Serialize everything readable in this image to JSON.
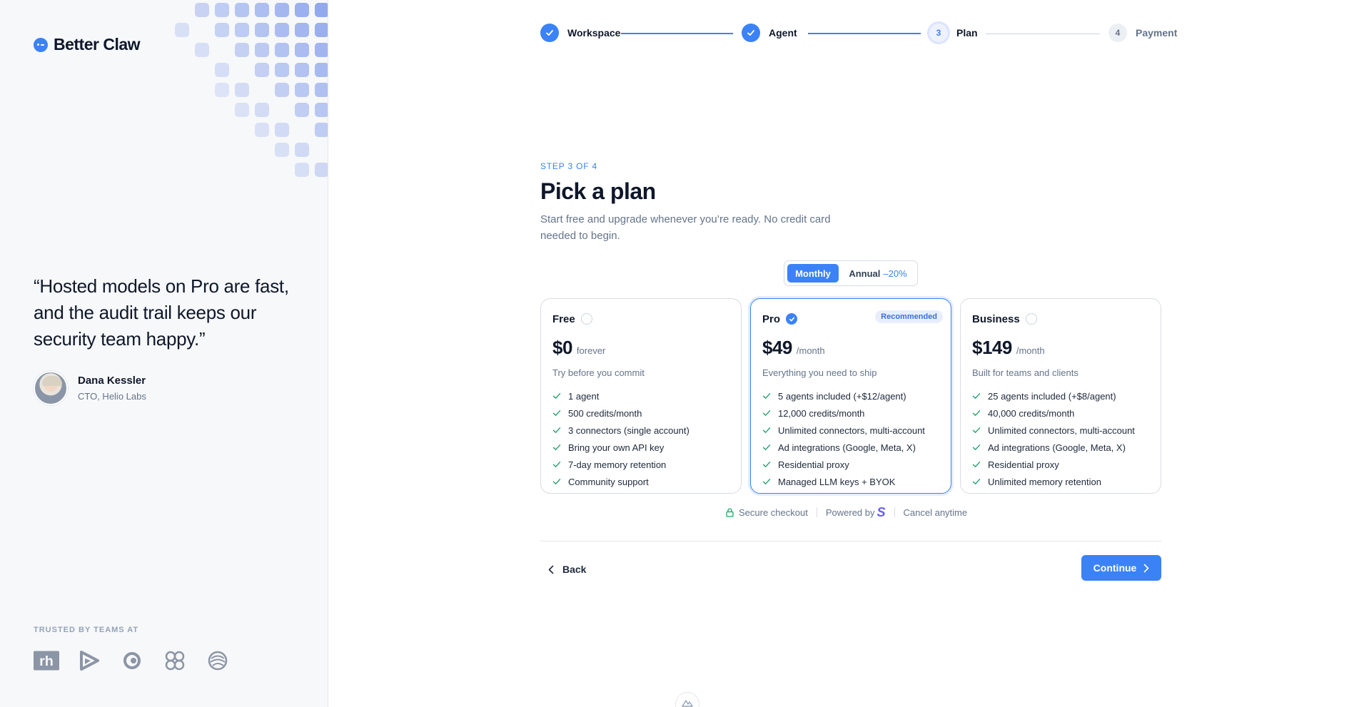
{
  "brand": {
    "name": "Better Claw",
    "accent": "#3b82f6",
    "mark_icon": "brand-mark-icon"
  },
  "testimonial": {
    "quote": "“Hosted models on Pro are fast, and the audit trail keeps our security team happy.”",
    "author": "Dana Kessler",
    "role": "CTO, Helio Labs"
  },
  "trusted": {
    "label": "TRUSTED BY TEAMS AT",
    "logos": [
      "rh-logo",
      "play-logo",
      "ring-logo",
      "knot-logo",
      "globe-logo"
    ],
    "rh_text": "rh"
  },
  "stepper": {
    "steps": [
      {
        "number": "1",
        "label": "Workspace",
        "state": "done"
      },
      {
        "number": "2",
        "label": "Agent",
        "state": "done"
      },
      {
        "number": "3",
        "label": "Plan",
        "state": "current"
      },
      {
        "number": "4",
        "label": "Payment",
        "state": "todo"
      }
    ]
  },
  "header": {
    "kicker": "STEP 3 OF 4",
    "title": "Pick a plan",
    "subtitle": "Start free and upgrade whenever you’re ready. No credit card needed to begin."
  },
  "billing_toggle": {
    "monthly": "Monthly",
    "annual": "Annual",
    "annual_discount": "–20%",
    "selected": "Monthly"
  },
  "plans": [
    {
      "name": "Free",
      "price": "$0",
      "period": "forever",
      "description": "Try before you commit",
      "selected": false,
      "features": [
        "1 agent",
        "500 credits/month",
        "3 connectors (single account)",
        "Bring your own API key",
        "7-day memory retention",
        "Community support"
      ]
    },
    {
      "name": "Pro",
      "price": "$49",
      "period": "/month",
      "description": "Everything you need to ship",
      "selected": true,
      "badge": "Recommended",
      "features": [
        "5 agents included (+$12/agent)",
        "12,000 credits/month",
        "Unlimited connectors, multi-account",
        "Ad integrations (Google, Meta, X)",
        "Residential proxy",
        "Managed LLM keys + BYOK"
      ]
    },
    {
      "name": "Business",
      "price": "$149",
      "period": "/month",
      "description": "Built for teams and clients",
      "selected": false,
      "features": [
        "25 agents included (+$8/agent)",
        "40,000 credits/month",
        "Unlimited connectors, multi-account",
        "Ad integrations (Google, Meta, X)",
        "Residential proxy",
        "Unlimited memory retention"
      ]
    }
  ],
  "footer_note": {
    "secure": "Secure checkout",
    "powered_by": "Powered by",
    "stripe_mark": "S",
    "cancel": "Cancel anytime"
  },
  "actions": {
    "back": "Back",
    "continue": "Continue"
  },
  "colors": {
    "primary": "#3b82f6",
    "check": "#22a06b",
    "text": "#0f172a",
    "muted": "#64748b"
  }
}
